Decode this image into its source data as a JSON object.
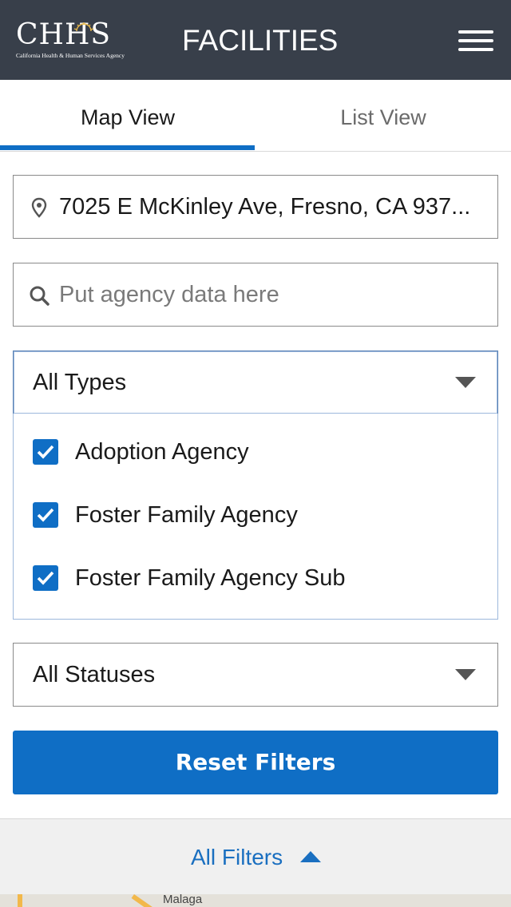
{
  "header": {
    "logo_text": "CHHS",
    "logo_subtext": "California Health & Human Services Agency",
    "title": "FACILITIES",
    "menu_icon": "hamburger-menu-icon"
  },
  "tabs": [
    {
      "label": "Map View",
      "active": true
    },
    {
      "label": "List View",
      "active": false
    }
  ],
  "location": {
    "icon": "location-pin-icon",
    "value": "7025 E McKinley Ave, Fresno, CA 937..."
  },
  "search": {
    "icon": "search-icon",
    "placeholder": "Put agency data here"
  },
  "type_filter": {
    "selected": "All Types",
    "open": true,
    "options": [
      {
        "label": "Adoption Agency",
        "checked": true
      },
      {
        "label": "Foster Family Agency",
        "checked": true
      },
      {
        "label": "Foster Family Agency Sub",
        "checked": true
      }
    ]
  },
  "status_filter": {
    "selected": "All Statuses"
  },
  "reset_button": {
    "label": "Reset Filters"
  },
  "filters_bar": {
    "label": "All Filters",
    "icon": "chevron-up-icon"
  },
  "map": {
    "place_label": "Malaga"
  },
  "colors": {
    "header_bg": "#383f4a",
    "accent": "#0f6ec5",
    "link": "#1a6fc0"
  }
}
